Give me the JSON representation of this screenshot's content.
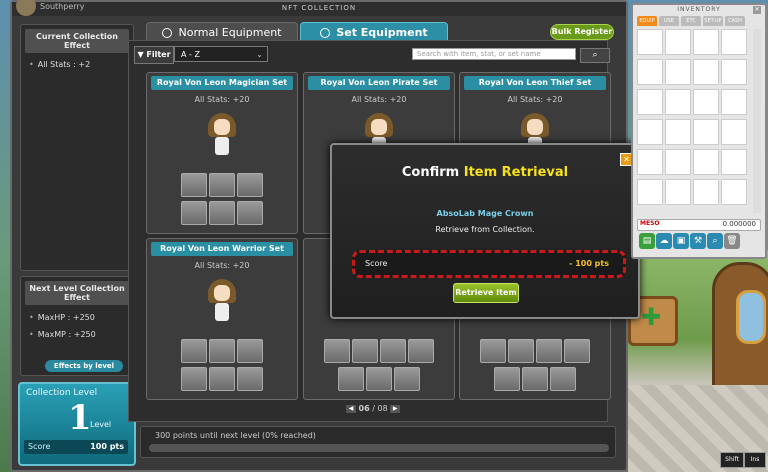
{
  "window": {
    "title": "NFT COLLECTION",
    "user_name": "Southperry"
  },
  "left_panel": {
    "current_effect_header": "Current Collection Effect",
    "current_effects": [
      "All Stats : +2"
    ],
    "next_level_header": "Next Level Collection Effect",
    "next_effects": [
      "MaxHP : +250",
      "MaxMP : +250"
    ],
    "effects_by_level_label": "Effects by level",
    "collection_level_label": "Collection Level",
    "collection_level": "1",
    "level_word": "Level",
    "score_label": "Score",
    "score_value": "100 pts"
  },
  "tabs": {
    "normal_label": "Normal Equipment",
    "set_label": "Set Equipment",
    "bulk_register_label": "Bulk Register"
  },
  "toolbar": {
    "filter_label": "Filter",
    "sort_value": "A - Z",
    "search_placeholder": "Search with item, stat, or set name",
    "search_icon": "search-icon"
  },
  "cards": [
    {
      "title": "Royal Von Leon Magician Set",
      "stat": "All Stats: +20"
    },
    {
      "title": "Royal Von Leon Pirate Set",
      "stat": "All Stats: +20"
    },
    {
      "title": "Royal Von Leon Thief Set",
      "stat": "All Stats: +20"
    },
    {
      "title": "Royal Von Leon Warrior Set",
      "stat": "All Stats: +20"
    }
  ],
  "pager": {
    "current": "06",
    "separator": "/",
    "total": "08"
  },
  "progress": {
    "text": "300 points until next level (0% reached)",
    "percent": 0
  },
  "modal": {
    "title_plain": "Confirm",
    "title_highlight": "Item Retrieval",
    "item_name": "AbsoLab Mage Crown",
    "subtitle": "Retrieve from Collection.",
    "score_label": "Score",
    "score_value": "- 100 pts",
    "retrieve_label": "Retrieve Item",
    "close_glyph": "✕"
  },
  "inventory": {
    "title": "INVENTORY",
    "tabs": [
      "EQUIP",
      "USE",
      "ETC",
      "SET-UP",
      "CASH"
    ],
    "meso_label": "MESO",
    "meso_value": "0.000000"
  },
  "keys": {
    "shift": "Shift",
    "ins": "Ins"
  },
  "colors": {
    "accent": "#2a8fa3",
    "modal_highlight": "#f6e21a",
    "alert_border": "#c81a1a"
  }
}
